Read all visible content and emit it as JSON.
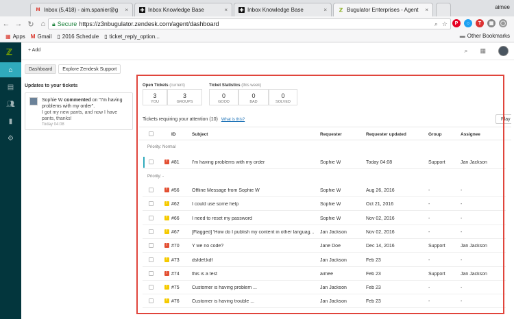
{
  "browser": {
    "tabs": [
      {
        "label": "Inbox (5,418) - aim.spanier@g",
        "icon": "gmail-icon"
      },
      {
        "label": "Inbox Knowledge Base",
        "icon": "zendesk-icon"
      },
      {
        "label": "Inbox Knowledge Base",
        "icon": "zendesk-icon"
      },
      {
        "label": "Bugulator Enterprises - Agent",
        "icon": "zendesk-green-icon"
      }
    ],
    "user": "aimee",
    "secure_label": "Secure",
    "url": "https://z3nbugulator.zendesk.com/agent/dashboard",
    "bookmarks": [
      "Apps",
      "Gmail",
      "2016 Schedule",
      "ticket_reply_option..."
    ],
    "other_bookmarks": "Other Bookmarks"
  },
  "header": {
    "add_label": "+ Add"
  },
  "subtabs": [
    "Dashboard",
    "Explore Zendesk Support"
  ],
  "updates": {
    "title": "Updates to your tickets",
    "author": "Sophie W",
    "action": "commented",
    "subject": "on \"I'm having problems with my order\".",
    "body": "I got my new pants, and now I have pants, thanks!",
    "time": "Today 04:08"
  },
  "open_tickets": {
    "title": "Open Tickets",
    "subtitle": "(current)",
    "stats": [
      {
        "value": "3",
        "label": "YOU"
      },
      {
        "value": "3",
        "label": "GROUPS"
      }
    ]
  },
  "ticket_statistics": {
    "title": "Ticket Statistics",
    "subtitle": "(this week)",
    "stats": [
      {
        "value": "0",
        "label": "GOOD"
      },
      {
        "value": "0",
        "label": "BAD"
      },
      {
        "value": "0",
        "label": "SOLVED"
      }
    ]
  },
  "table": {
    "title": "Tickets requiring your attention (10)",
    "help_link": "What is this?",
    "play_label": "Play",
    "columns": [
      "ID",
      "Subject",
      "Requester",
      "Requester updated",
      "Group",
      "Assignee"
    ],
    "groups": [
      {
        "label": "Priority: Normal",
        "rows": [
          {
            "status": "red",
            "id": "#81",
            "subject": "I'm having problems with my order",
            "requester": "Sophie W",
            "updated": "Today 04:08",
            "group": "Support",
            "assignee": "Jan Jackson"
          }
        ]
      },
      {
        "label": "Priority: -",
        "rows": [
          {
            "status": "red",
            "id": "#56",
            "subject": "Offline Message from Sophie W",
            "requester": "Sophie W",
            "updated": "Aug 26, 2016",
            "group": "-",
            "assignee": "-"
          },
          {
            "status": "yellow",
            "id": "#62",
            "subject": "I could use some help",
            "requester": "Sophie W",
            "updated": "Oct 21, 2016",
            "group": "-",
            "assignee": "-"
          },
          {
            "status": "yellow",
            "id": "#66",
            "subject": "I need to reset my password",
            "requester": "Sophie W",
            "updated": "Nov 02, 2016",
            "group": "-",
            "assignee": "-"
          },
          {
            "status": "yellow",
            "id": "#67",
            "subject": "[Flagged] 'How do I publish my content in other languag...",
            "requester": "Jan Jackson",
            "updated": "Nov 02, 2016",
            "group": "-",
            "assignee": "-"
          },
          {
            "status": "red",
            "id": "#70",
            "subject": "Y we no code?",
            "requester": "Jane Doe",
            "updated": "Dec 14, 2016",
            "group": "Support",
            "assignee": "Jan Jackson"
          },
          {
            "status": "yellow",
            "id": "#73",
            "subject": "dsfdef;kdf",
            "requester": "Jan Jackson",
            "updated": "Feb 23",
            "group": "-",
            "assignee": "-"
          },
          {
            "status": "red",
            "id": "#74",
            "subject": "this is a test",
            "requester": "aimee",
            "updated": "Feb 23",
            "group": "Support",
            "assignee": "Jan Jackson"
          },
          {
            "status": "yellow",
            "id": "#75",
            "subject": "Customer is having problem ...",
            "requester": "Jan Jackson",
            "updated": "Feb 23",
            "group": "-",
            "assignee": "-"
          },
          {
            "status": "yellow",
            "id": "#76",
            "subject": "Customer is having trouble ...",
            "requester": "Jan Jackson",
            "updated": "Feb 23",
            "group": "-",
            "assignee": "-"
          }
        ]
      }
    ]
  },
  "colors": {
    "status_red": "#e34f32",
    "status_yellow": "#f5ca00",
    "sidebar": "#03363d",
    "sidebar_active": "#30aabc",
    "highlight": "#e0443b"
  }
}
